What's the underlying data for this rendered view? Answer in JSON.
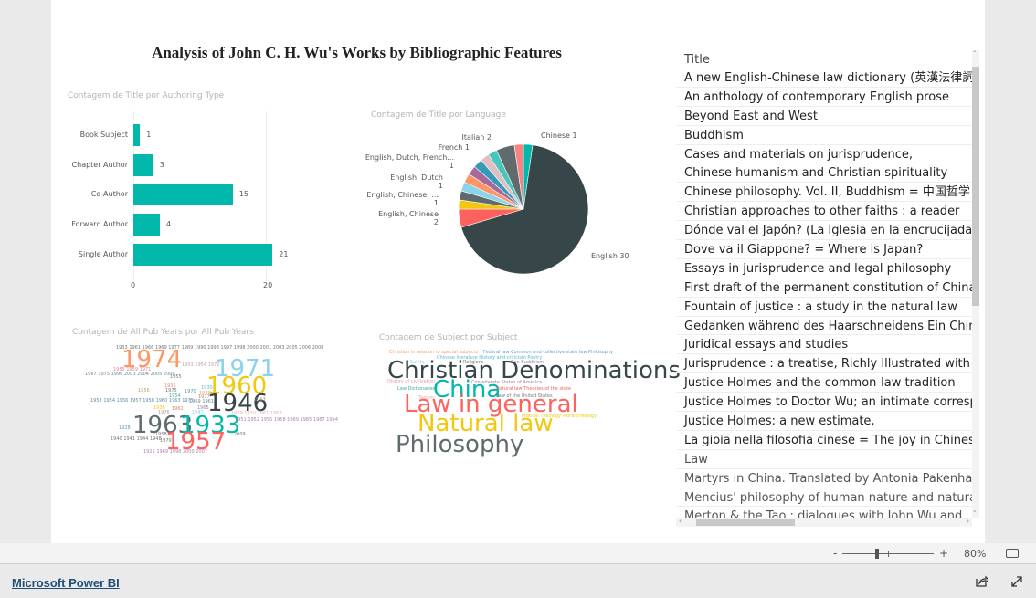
{
  "report": {
    "title": "Analysis of John C. H. Wu's Works by Bibliographic Features"
  },
  "bar_visual": {
    "title": "Contagem de Title por Authoring Type"
  },
  "pie_visual": {
    "title": "Contagem de Title por Language"
  },
  "year_cloud": {
    "title": "Contagem de All Pub Years por All Pub Years",
    "words": [
      {
        "text": "1933 1961 1966 1969 1977 1989 1990 1993 1997 1998 2000 2001 2003 2005 2006 2008",
        "color": "#777777"
      },
      {
        "text": "1974",
        "color": "#fe9666"
      },
      {
        "text": "1953 1954 1972",
        "color": "#c0a0a8"
      },
      {
        "text": "1971",
        "color": "#8ad4eb"
      },
      {
        "text": "1955 1959 1971",
        "color": "#e08090"
      },
      {
        "text": "1967 1975 1996 2003 2004 2005 2008",
        "color": "#6a8a95"
      },
      {
        "text": "1955",
        "color": "#777777"
      },
      {
        "text": "1960",
        "color": "#f2c80f"
      },
      {
        "text": "1935",
        "color": "#f08080"
      },
      {
        "text": "1956",
        "color": "#b5a060"
      },
      {
        "text": "1975",
        "color": "#777777"
      },
      {
        "text": "1970",
        "color": "#5aa0a0"
      },
      {
        "text": "1930",
        "color": "#5ac0b8"
      },
      {
        "text": "1949",
        "color": "#fe9666"
      },
      {
        "text": "1954",
        "color": "#40a8a0"
      },
      {
        "text": "1977",
        "color": "#b09060"
      },
      {
        "text": "1946",
        "color": "#374649"
      },
      {
        "text": "1953 1954 1956 1957 1958 1960 1963 1975",
        "color": "#5b8fa0"
      },
      {
        "text": "1969 1961",
        "color": "#6a8a95"
      },
      {
        "text": "2013",
        "color": "#a08080"
      },
      {
        "text": "1936",
        "color": "#f2c80f"
      },
      {
        "text": "1962",
        "color": "#d08070"
      },
      {
        "text": "1965",
        "color": "#a080a0"
      },
      {
        "text": "1976",
        "color": "#c090a0"
      },
      {
        "text": "1947",
        "color": "#8ad4eb"
      },
      {
        "text": "1929 1930 1961 1963",
        "color": "#e8b0b8"
      },
      {
        "text": "1963",
        "color": "#5f6b6d"
      },
      {
        "text": "1933",
        "color": "#01b8aa"
      },
      {
        "text": "1951 1952 1955 1958 1969 1985 1987 1994",
        "color": "#b080b0"
      },
      {
        "text": "1928",
        "color": "#5aa0c8"
      },
      {
        "text": "1958",
        "color": "#777777"
      },
      {
        "text": "2009",
        "color": "#777777"
      },
      {
        "text": "1940 1941 1944 1948",
        "color": "#777777"
      },
      {
        "text": "1979",
        "color": "#777777"
      },
      {
        "text": "1957",
        "color": "#fd625e"
      },
      {
        "text": "1925 1969 1998 2000 2007",
        "color": "#b080b0"
      }
    ]
  },
  "subject_cloud": {
    "title": "Contagem de Subject por Subject",
    "words": [
      {
        "text": "Christian in relation to special subjects",
        "color": "#fe9666"
      },
      {
        "text": "Federal law Common and collective state law Philosophy",
        "color": "#5aa0c8"
      },
      {
        "text": "Chinese literature History and criticism Poetry",
        "color": "#5ab8d8"
      },
      {
        "text": "Saints",
        "color": "#8ad4eb"
      },
      {
        "text": "Religions",
        "color": "#777777"
      },
      {
        "text": "Zen Buddhism",
        "color": "#a080a0"
      },
      {
        "text": "Christian Denominations",
        "color": "#374649"
      },
      {
        "text": "History of civilization",
        "color": "#e0a0b0"
      },
      {
        "text": "Confederate States of America",
        "color": "#a080a0"
      },
      {
        "text": "China",
        "color": "#01b8aa"
      },
      {
        "text": "Law Dictionaries",
        "color": "#40a8a0"
      },
      {
        "text": "Natural law Theories of the state",
        "color": "#f06060"
      },
      {
        "text": "Taoism",
        "color": "#f0a0b0"
      },
      {
        "text": "Law of the United States",
        "color": "#777777"
      },
      {
        "text": "Law in general",
        "color": "#fd625e"
      },
      {
        "text": "Pratical Theology Moral theology",
        "color": "#f2c80f"
      },
      {
        "text": "Natural law",
        "color": "#f2c80f"
      },
      {
        "text": "Philosophy",
        "color": "#5f6b6d"
      }
    ]
  },
  "table": {
    "header": "Title",
    "rows": [
      "A new English-Chinese law dictionary (英漢法律詞典)",
      "An anthology of contemporary English prose",
      "Beyond East and West",
      "Buddhism",
      "Cases and materials on jurisprudence,",
      "Chinese humanism and Christian spirituality",
      "Chinese philosophy. Vol. II, Buddhism = 中国哲学",
      "Christian approaches to other faiths : a reader",
      "Dónde val el Japón? (La Iglesia en la encrucijada",
      "Dove va il Giappone? = Where is Japan?",
      "Essays in jurisprudence and legal philosophy",
      "First draft of the permanent constitution of China",
      "Fountain of justice : a study in the natural law",
      "Gedanken während des Haarschneidens Ein Chinese",
      "Juridical essays and studies",
      "Jurisprudence : a treatise, Richly Illustrated with",
      "Justice Holmes and the common-law tradition",
      "Justice Holmes to Doctor Wu; an intimate correspondence",
      "Justice Holmes: a new estimate,",
      "La gioia nella filosofia cinese = The joy in Chinese",
      "Law",
      "Martyrs in China. Translated by Antonia Pakenham",
      "Mencius' philosophy of human nature and natural",
      "Merton & the Tao : dialogues with John Wu and"
    ]
  },
  "zoom": {
    "minus": "-",
    "plus": "+",
    "level": "80%",
    "slider_fraction": 0.38
  },
  "footer": {
    "link": "Microsoft Power BI"
  },
  "chart_data": [
    {
      "type": "bar",
      "orientation": "horizontal",
      "title": "Contagem de Title por Authoring Type",
      "categories": [
        "Book Subject",
        "Chapter Author",
        "Co-Author",
        "Forward Author",
        "Single Author"
      ],
      "values": [
        1,
        3,
        15,
        4,
        21
      ],
      "xlim": [
        0,
        25
      ],
      "ticks": [
        "0",
        "20"
      ],
      "color": "#01b8aa",
      "grid": true
    },
    {
      "type": "pie",
      "title": "Contagem de Title por Language",
      "slices": [
        {
          "label": "Chinese",
          "value": 1,
          "color": "#01b8aa",
          "shown": "Chinese 1"
        },
        {
          "label": "English",
          "value": 30,
          "color": "#374649",
          "shown": "English 30"
        },
        {
          "label": "English, Chinese",
          "value": 2,
          "color": "#fd625e",
          "shown": "English, Chinese\n2"
        },
        {
          "label": "English, Chinese, ...",
          "value": 1,
          "color": "#f2c80f",
          "shown": "English, Chinese, ...\n1"
        },
        {
          "label": "",
          "value": 1,
          "color": "#5f6b6d",
          "shown": ""
        },
        {
          "label": "English, Dutch",
          "value": 1,
          "color": "#8ad4eb",
          "shown": "English, Dutch\n1"
        },
        {
          "label": "",
          "value": 1,
          "color": "#fe9666",
          "shown": ""
        },
        {
          "label": "English, Dutch, French...",
          "value": 1,
          "color": "#a66999",
          "shown": "English, Dutch, French...\n1"
        },
        {
          "label": "",
          "value": 1,
          "color": "#3599b8",
          "shown": ""
        },
        {
          "label": "",
          "value": 1,
          "color": "#dfbfbf",
          "shown": ""
        },
        {
          "label": "French",
          "value": 1,
          "color": "#4ac5bb",
          "shown": "French 1"
        },
        {
          "label": "Italian",
          "value": 2,
          "color": "#5f6b6d",
          "shown": "Italian 2"
        },
        {
          "label": "",
          "value": 1,
          "color": "#fb8281",
          "shown": ""
        }
      ]
    }
  ]
}
